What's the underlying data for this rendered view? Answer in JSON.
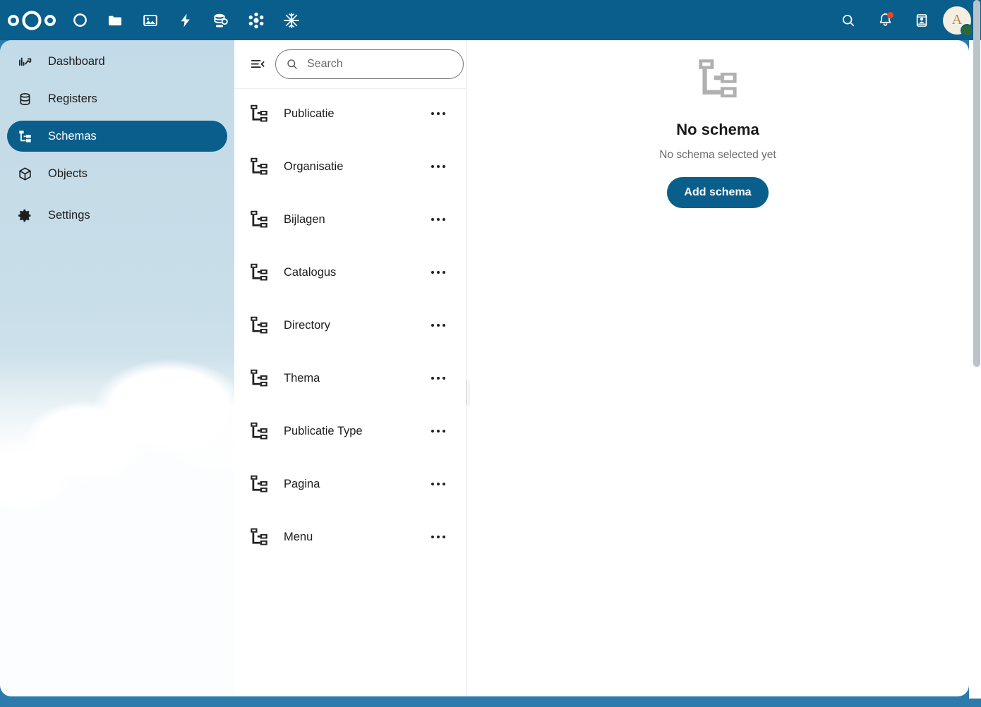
{
  "header": {
    "logo_name": "nextcloud-logo",
    "apps": [
      {
        "name": "dashboard-app-icon",
        "label": "Dashboard"
      },
      {
        "name": "files-app-icon",
        "label": "Files"
      },
      {
        "name": "photos-app-icon",
        "label": "Photos"
      },
      {
        "name": "activity-app-icon",
        "label": "Activity"
      },
      {
        "name": "openregister-app-icon",
        "label": "Open Register"
      },
      {
        "name": "openconnector-app-icon",
        "label": "Open Connector"
      },
      {
        "name": "opencatalogi-app-icon",
        "label": "Open Catalogi"
      }
    ],
    "search_label": "Search",
    "notifications_label": "Notifications",
    "contacts_label": "Contacts",
    "avatar_initial": "A",
    "status": "online",
    "bar_color": "#0a5e8c"
  },
  "sidebar": {
    "items": [
      {
        "label": "Dashboard",
        "icon": "chart-timeline-variant-icon",
        "active": false
      },
      {
        "label": "Registers",
        "icon": "database-icon",
        "active": false
      },
      {
        "label": "Schemas",
        "icon": "sitemap-icon",
        "active": true
      },
      {
        "label": "Objects",
        "icon": "cube-outline-icon",
        "active": false
      },
      {
        "label": "Settings",
        "icon": "cog-icon",
        "active": false
      }
    ],
    "active_color": "#0a5e8c"
  },
  "list_panel": {
    "collapse_label": "Collapse list",
    "search": {
      "placeholder": "Search",
      "value": ""
    },
    "actions_label": "List actions",
    "items": [
      {
        "label": "Publicatie",
        "icon": "sitemap-icon"
      },
      {
        "label": "Organisatie",
        "icon": "sitemap-icon"
      },
      {
        "label": "Bijlagen",
        "icon": "sitemap-icon"
      },
      {
        "label": "Catalogus",
        "icon": "sitemap-icon"
      },
      {
        "label": "Directory",
        "icon": "sitemap-icon"
      },
      {
        "label": "Thema",
        "icon": "sitemap-icon"
      },
      {
        "label": "Publicatie Type",
        "icon": "sitemap-icon"
      },
      {
        "label": "Pagina",
        "icon": "sitemap-icon"
      },
      {
        "label": "Menu",
        "icon": "sitemap-icon"
      }
    ]
  },
  "detail": {
    "empty_icon": "sitemap-icon",
    "title": "No schema",
    "subtitle": "No schema selected yet",
    "button_label": "Add schema",
    "button_color": "#0a5e8c"
  }
}
